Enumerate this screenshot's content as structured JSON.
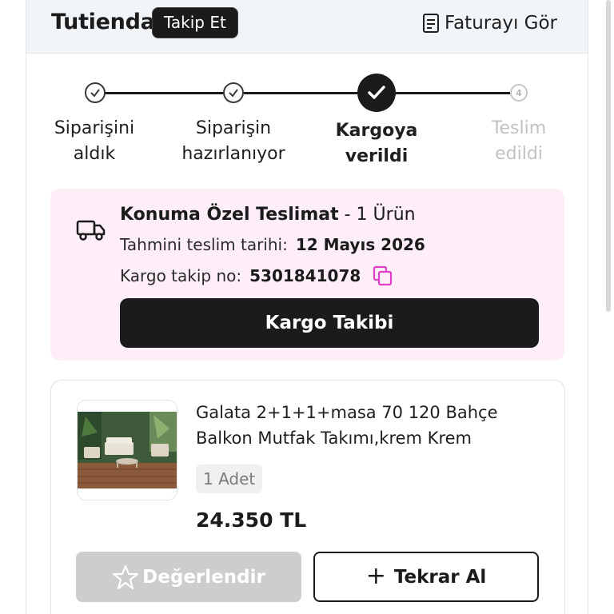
{
  "header": {
    "store_name": "Tutienda",
    "follow_label": "Takip Et",
    "invoice_label": "Faturayı Gör"
  },
  "stepper": {
    "steps": [
      {
        "line1": "Siparişini",
        "line2": "aldık",
        "state": "done"
      },
      {
        "line1": "Siparişin",
        "line2": "hazırlanıyor",
        "state": "done"
      },
      {
        "line1": "Kargoya",
        "line2": "verildi",
        "state": "current"
      },
      {
        "line1": "Teslim",
        "line2": "edildi",
        "state": "pending",
        "number": "4"
      }
    ]
  },
  "delivery": {
    "title_bold": "Konuma Özel Teslimat",
    "title_rest": " - 1 Ürün",
    "eta_label": "Tahmini teslim tarihi:",
    "eta_value": "12 Mayıs 2026",
    "tracking_label": "Kargo takip no:",
    "tracking_value": "5301841078",
    "track_button": "Kargo Takibi",
    "accent_color": "#e040c8",
    "bg_color": "#fdeef8"
  },
  "product": {
    "title": "Galata 2+1+1+masa 70 120 Bahçe Balkon Mutfak Takımı,krem Krem",
    "quantity": "1 Adet",
    "price": "24.350 TL",
    "rate_button": "Değerlendir",
    "reorder_button": "Tekrar Al"
  }
}
